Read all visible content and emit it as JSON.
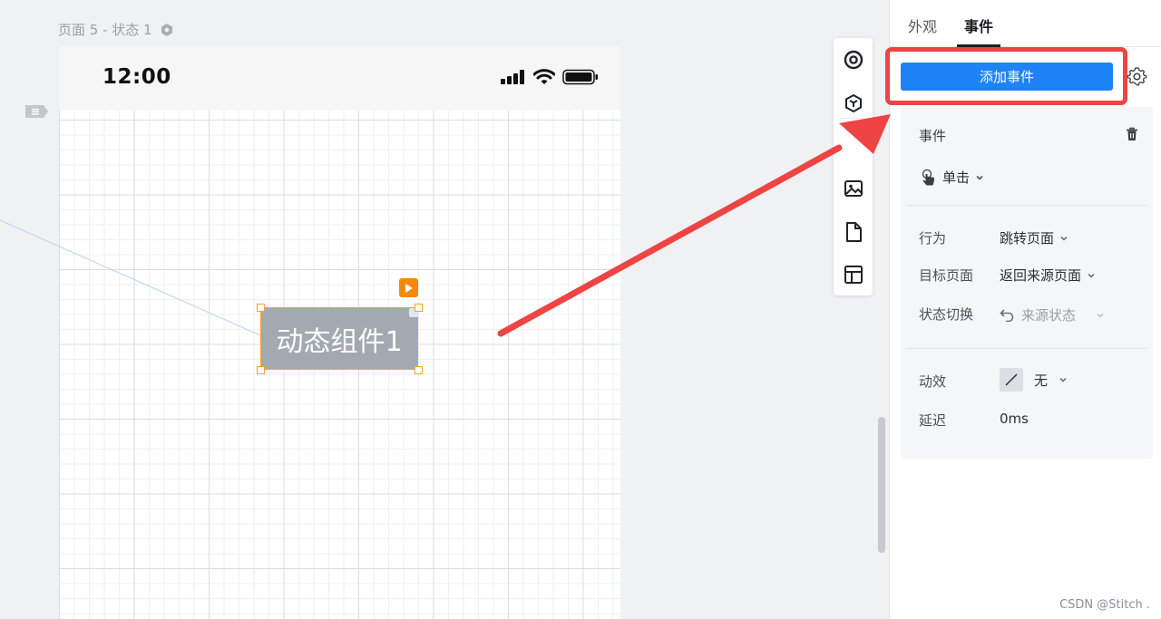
{
  "canvas": {
    "page_label": "页面 5 - 状态 1",
    "phone": {
      "time": "12:00"
    },
    "component": {
      "label": "动态组件1"
    }
  },
  "toolbar": {
    "icons": [
      "target-icon",
      "box-icon",
      "image-icon",
      "document-icon",
      "layout-icon"
    ]
  },
  "panel": {
    "tabs": [
      {
        "label": "外观",
        "active": false
      },
      {
        "label": "事件",
        "active": true
      }
    ],
    "add_event_label": "添加事件",
    "event_card": {
      "title": "事件",
      "trigger": "单击",
      "rows": {
        "action_label": "行为",
        "action_value": "跳转页面",
        "target_label": "目标页面",
        "target_value": "返回来源页面",
        "state_label": "状态切换",
        "state_value": "来源状态",
        "effect_label": "动效",
        "effect_value": "无",
        "delay_label": "延迟",
        "delay_value": "0ms"
      }
    }
  },
  "annotation": {
    "color": "#ee4444"
  },
  "watermark": "CSDN @Stitch ."
}
